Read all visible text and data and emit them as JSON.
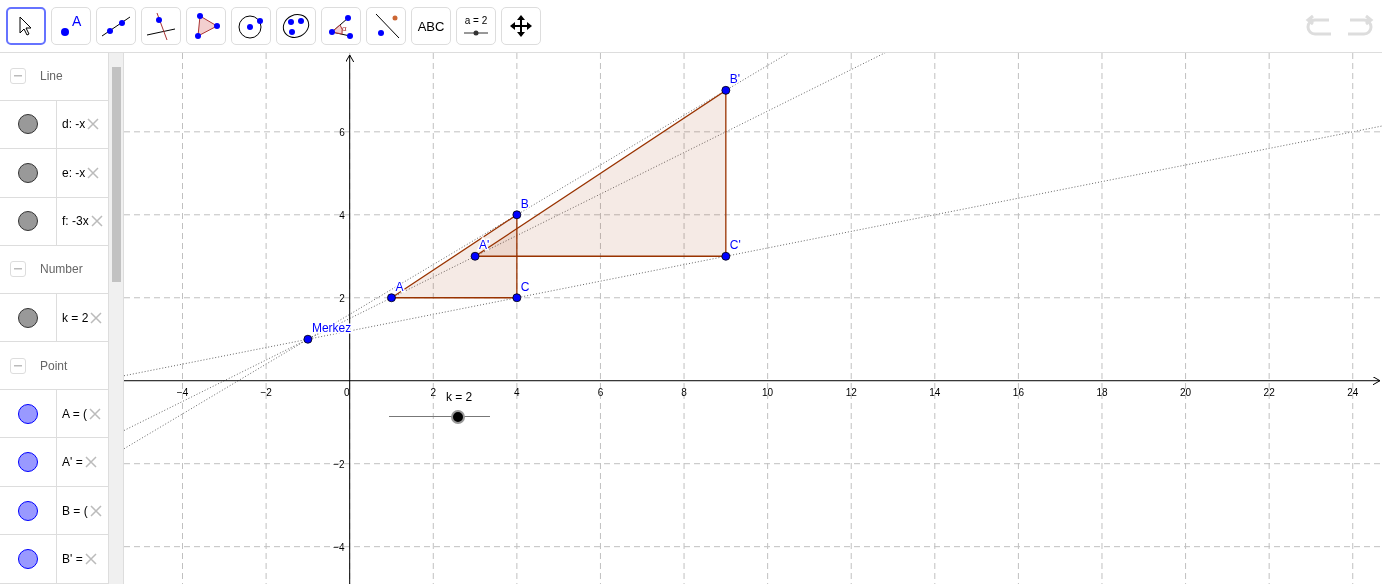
{
  "toolbar": {
    "tools": [
      {
        "kind": "pointer",
        "selected": true
      },
      {
        "kind": "point",
        "label": "A",
        "selected": false
      },
      {
        "kind": "line",
        "selected": false
      },
      {
        "kind": "perpendicular",
        "selected": false
      },
      {
        "kind": "polygon",
        "selected": false
      },
      {
        "kind": "circle",
        "selected": false
      },
      {
        "kind": "conic",
        "selected": false
      },
      {
        "kind": "angle",
        "label": "α",
        "selected": false
      },
      {
        "kind": "reflect",
        "selected": false
      },
      {
        "kind": "text",
        "label": "ABC",
        "selected": false
      },
      {
        "kind": "slider",
        "label": "a = 2",
        "selected": false
      },
      {
        "kind": "move-view",
        "selected": false
      }
    ],
    "undo": {
      "disabled": true
    },
    "redo": {
      "disabled": true
    }
  },
  "algebra": {
    "groups": [
      {
        "title": "Line",
        "items": [
          {
            "text": "d: -x",
            "visible": true,
            "color": "#999999"
          },
          {
            "text": "e: -x",
            "visible": true,
            "color": "#999999"
          },
          {
            "text": "f: -3x",
            "visible": true,
            "color": "#999999"
          }
        ]
      },
      {
        "title": "Number",
        "items": [
          {
            "text": "k = 2",
            "visible": true,
            "color": "#999999"
          }
        ]
      },
      {
        "title": "Point",
        "items": [
          {
            "text": "A = (",
            "visible": true,
            "color": "#9999ff"
          },
          {
            "text": "A' =",
            "visible": true,
            "color": "#9999ff"
          },
          {
            "text": "B = (",
            "visible": true,
            "color": "#9999ff"
          },
          {
            "text": "B' =",
            "visible": true,
            "color": "#9999ff"
          }
        ]
      }
    ]
  },
  "graphics": {
    "slider": {
      "label": "k = 2",
      "level": 0.69
    },
    "chart_data": {
      "type": "scatter",
      "xlim": [
        -5.4,
        24.7
      ],
      "ylim": [
        -4.9,
        7.9
      ],
      "grid": true,
      "xticks": [
        -4,
        -2,
        0,
        2,
        4,
        6,
        8,
        10,
        12,
        14,
        16,
        18,
        20,
        22,
        24
      ],
      "yticks": [
        -4,
        -2,
        2,
        4,
        6
      ],
      "x": [
        -1,
        1,
        4,
        4,
        3,
        9,
        9
      ],
      "series": [
        {
          "color": "#0000ff",
          "values": [
            1,
            2,
            4,
            2,
            3,
            7,
            3
          ]
        }
      ],
      "annotations": [
        {
          "text": "Merkez",
          "x": -1,
          "y": 1
        },
        {
          "text": "A",
          "x": 1,
          "y": 2
        },
        {
          "text": "B",
          "x": 4,
          "y": 4
        },
        {
          "text": "C",
          "x": 4,
          "y": 2
        },
        {
          "text": "A'",
          "x": 3,
          "y": 3
        },
        {
          "text": "B'",
          "x": 9,
          "y": 7
        },
        {
          "text": "C'",
          "x": 9,
          "y": 3
        }
      ]
    }
  }
}
